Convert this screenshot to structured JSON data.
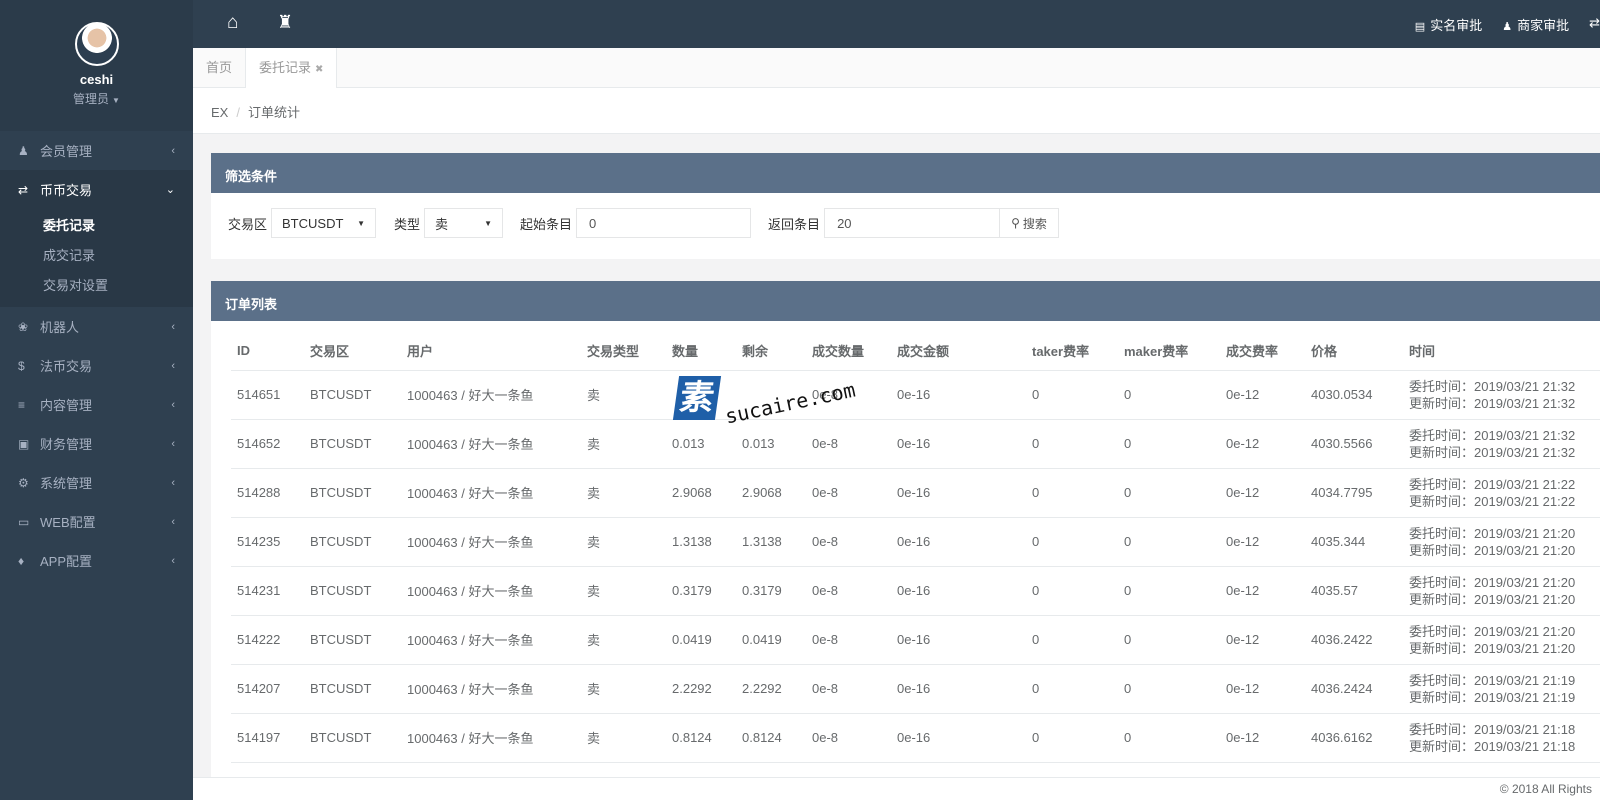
{
  "profile": {
    "name": "ceshi",
    "role": "管理员"
  },
  "sidebar": {
    "items": [
      {
        "label": "会员管理",
        "icon": "user-icon",
        "glyph": "♟"
      },
      {
        "label": "币币交易",
        "icon": "exchange-icon",
        "glyph": "⇄"
      },
      {
        "label": "机器人",
        "icon": "paw-icon",
        "glyph": "❀"
      },
      {
        "label": "法币交易",
        "icon": "dollar-icon",
        "glyph": "$"
      },
      {
        "label": "内容管理",
        "icon": "bars-icon",
        "glyph": "≡"
      },
      {
        "label": "财务管理",
        "icon": "money-icon",
        "glyph": "▣"
      },
      {
        "label": "系统管理",
        "icon": "cogs-icon",
        "glyph": "⚙"
      },
      {
        "label": "WEB配置",
        "icon": "laptop-icon",
        "glyph": "▭"
      },
      {
        "label": "APP配置",
        "icon": "android-icon",
        "glyph": "♦"
      }
    ],
    "sub": [
      "委托记录",
      "成交记录",
      "交易对设置"
    ]
  },
  "topbar": {
    "approve_name": "实名审批",
    "approve_merchant": "商家审批"
  },
  "tabs": [
    "首页",
    "委托记录"
  ],
  "breadcrumb": {
    "root": "EX",
    "current": "订单统计"
  },
  "filter": {
    "title": "筛选条件",
    "market_label": "交易区",
    "market_value": "BTCUSDT",
    "type_label": "类型",
    "type_value": "卖",
    "start_label": "起始条目",
    "start_value": "0",
    "count_label": "返回条目",
    "count_value": "20",
    "search_label": "搜索"
  },
  "orders": {
    "title": "订单列表",
    "columns": [
      "ID",
      "交易区",
      "用户",
      "交易类型",
      "数量",
      "剩余",
      "成交数量",
      "成交金额",
      "taker费率",
      "maker费率",
      "成交费率",
      "价格",
      "时间"
    ],
    "rows": [
      {
        "id": "514651",
        "market": "BTCUSDT",
        "user": "1000463 / 好大一条鱼",
        "type": "卖",
        "qty": "",
        "remain": "",
        "filled": "0e-8",
        "amount": "0e-16",
        "taker": "0",
        "maker": "0",
        "fee": "0e-12",
        "price": "4030.0534",
        "t1": "委托时间：2019/03/21 21:32",
        "t2": "更新时间：2019/03/21 21:32"
      },
      {
        "id": "514652",
        "market": "BTCUSDT",
        "user": "1000463 / 好大一条鱼",
        "type": "卖",
        "qty": "0.013",
        "remain": "0.013",
        "filled": "0e-8",
        "amount": "0e-16",
        "taker": "0",
        "maker": "0",
        "fee": "0e-12",
        "price": "4030.5566",
        "t1": "委托时间：2019/03/21 21:32",
        "t2": "更新时间：2019/03/21 21:32"
      },
      {
        "id": "514288",
        "market": "BTCUSDT",
        "user": "1000463 / 好大一条鱼",
        "type": "卖",
        "qty": "2.9068",
        "remain": "2.9068",
        "filled": "0e-8",
        "amount": "0e-16",
        "taker": "0",
        "maker": "0",
        "fee": "0e-12",
        "price": "4034.7795",
        "t1": "委托时间：2019/03/21 21:22",
        "t2": "更新时间：2019/03/21 21:22"
      },
      {
        "id": "514235",
        "market": "BTCUSDT",
        "user": "1000463 / 好大一条鱼",
        "type": "卖",
        "qty": "1.3138",
        "remain": "1.3138",
        "filled": "0e-8",
        "amount": "0e-16",
        "taker": "0",
        "maker": "0",
        "fee": "0e-12",
        "price": "4035.344",
        "t1": "委托时间：2019/03/21 21:20",
        "t2": "更新时间：2019/03/21 21:20"
      },
      {
        "id": "514231",
        "market": "BTCUSDT",
        "user": "1000463 / 好大一条鱼",
        "type": "卖",
        "qty": "0.3179",
        "remain": "0.3179",
        "filled": "0e-8",
        "amount": "0e-16",
        "taker": "0",
        "maker": "0",
        "fee": "0e-12",
        "price": "4035.57",
        "t1": "委托时间：2019/03/21 21:20",
        "t2": "更新时间：2019/03/21 21:20"
      },
      {
        "id": "514222",
        "market": "BTCUSDT",
        "user": "1000463 / 好大一条鱼",
        "type": "卖",
        "qty": "0.0419",
        "remain": "0.0419",
        "filled": "0e-8",
        "amount": "0e-16",
        "taker": "0",
        "maker": "0",
        "fee": "0e-12",
        "price": "4036.2422",
        "t1": "委托时间：2019/03/21 21:20",
        "t2": "更新时间：2019/03/21 21:20"
      },
      {
        "id": "514207",
        "market": "BTCUSDT",
        "user": "1000463 / 好大一条鱼",
        "type": "卖",
        "qty": "2.2292",
        "remain": "2.2292",
        "filled": "0e-8",
        "amount": "0e-16",
        "taker": "0",
        "maker": "0",
        "fee": "0e-12",
        "price": "4036.2424",
        "t1": "委托时间：2019/03/21 21:19",
        "t2": "更新时间：2019/03/21 21:19"
      },
      {
        "id": "514197",
        "market": "BTCUSDT",
        "user": "1000463 / 好大一条鱼",
        "type": "卖",
        "qty": "0.8124",
        "remain": "0.8124",
        "filled": "0e-8",
        "amount": "0e-16",
        "taker": "0",
        "maker": "0",
        "fee": "0e-12",
        "price": "4036.6162",
        "t1": "委托时间：2019/03/21 21:18",
        "t2": "更新时间：2019/03/21 21:18"
      }
    ]
  },
  "watermark": {
    "cn": "素材熱",
    "url": "sucaire.com"
  },
  "footer": {
    "text": "© 2018 All Rights"
  },
  "colors": {
    "sidebar": "#2f4050",
    "panel_header": "#5b7089"
  }
}
